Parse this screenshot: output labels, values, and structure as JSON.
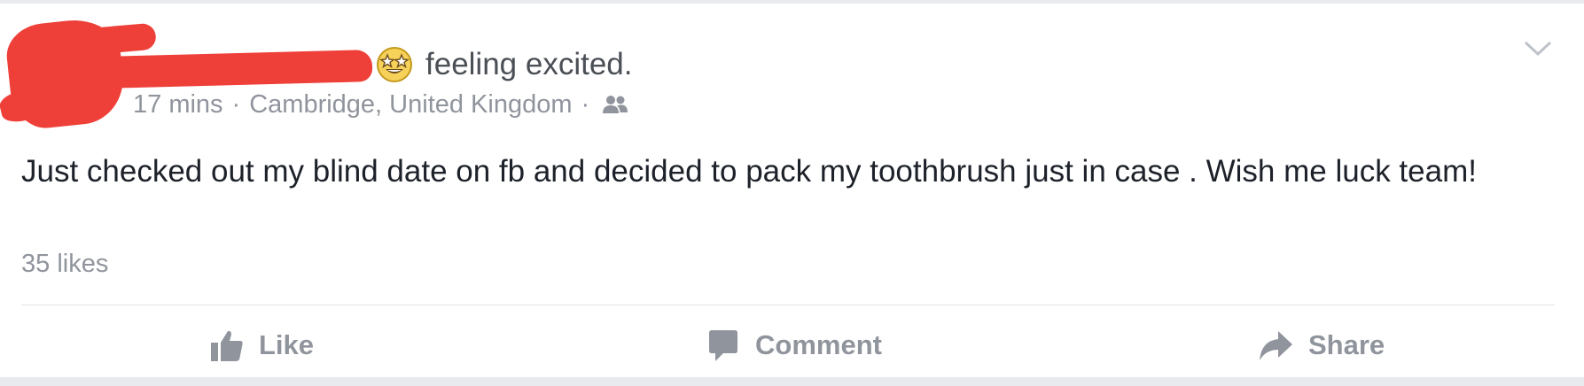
{
  "post": {
    "feeling_text": "feeling excited.",
    "emoji_icon": "star-struck-emoji-icon",
    "timestamp": "17 mins",
    "separator": "·",
    "location": "Cambridge, United Kingdom",
    "audience_icon": "friends-icon",
    "body": "Just checked out my blind date on fb and decided to pack my toothbrush just in case . Wish me luck team!",
    "likes": "35 likes"
  },
  "actions": {
    "like_label": "Like",
    "comment_label": "Comment",
    "share_label": "Share"
  },
  "colors": {
    "background": "#e9eaed",
    "card": "#ffffff",
    "text_primary": "#1d2129",
    "text_secondary": "#90949c",
    "redaction": "#ee3f38"
  }
}
